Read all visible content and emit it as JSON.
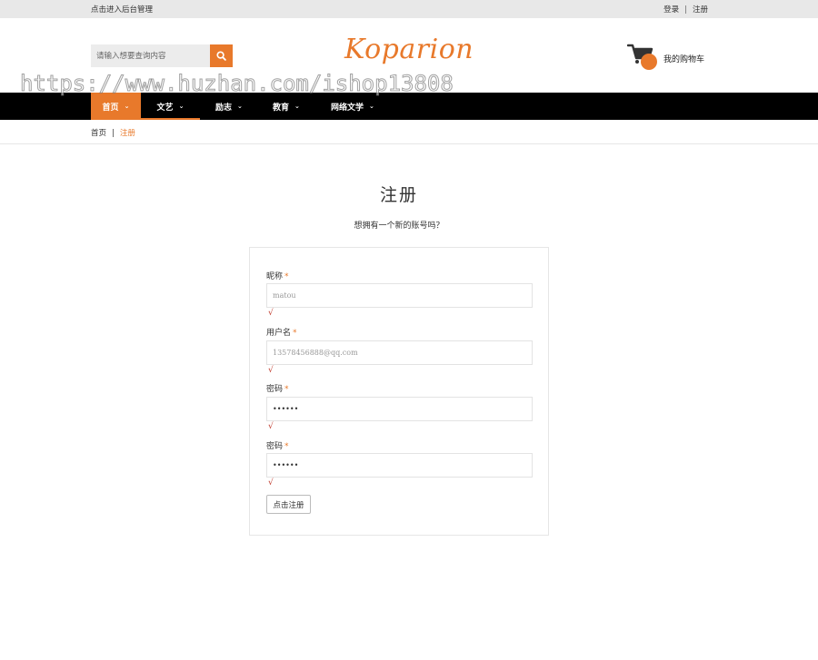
{
  "topbar": {
    "admin_link": "点击进入后台管理",
    "login": "登录",
    "separator": "|",
    "register": "注册"
  },
  "header": {
    "search_placeholder": "请输入想要查询内容",
    "search_icon": "search-icon",
    "logo_text": "Koparion",
    "cart_label": "我的购物车",
    "cart_icon": "cart-icon"
  },
  "watermark": "https://www.huzhan.com/ishop13808",
  "nav": {
    "items": [
      {
        "label": "首页",
        "chevron": "⌄"
      },
      {
        "label": "文艺",
        "chevron": "⌄"
      },
      {
        "label": "励志",
        "chevron": "⌄"
      },
      {
        "label": "教育",
        "chevron": "⌄"
      },
      {
        "label": "网络文学",
        "chevron": "⌄"
      }
    ]
  },
  "breadcrumb": {
    "home": "首页",
    "separator": "|",
    "current": "注册"
  },
  "page": {
    "title": "注册",
    "subtitle": "想拥有一个新的账号吗？"
  },
  "form": {
    "fields": [
      {
        "label": "昵称",
        "required": "*",
        "value": "matou",
        "check": "√"
      },
      {
        "label": "用户名",
        "required": "*",
        "value": "13578456888@qq.com",
        "check": "√"
      },
      {
        "label": "密码",
        "required": "*",
        "value": "••••••",
        "check": "√"
      },
      {
        "label": "密码",
        "required": "*",
        "value": "••••••",
        "check": "√"
      }
    ],
    "submit_label": "点击注册"
  },
  "colors": {
    "accent": "#e8792b",
    "nav_bg": "#000000",
    "topbar_bg": "#e8e8e8",
    "check": "#c0392b"
  }
}
